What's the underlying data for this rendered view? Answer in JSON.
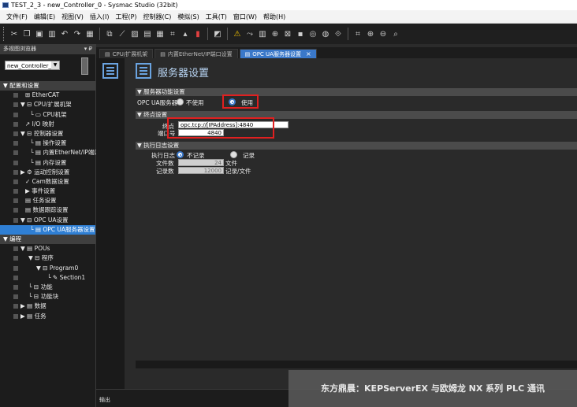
{
  "window": {
    "title": "TEST_2_3 - new_Controller_0 - Sysmac Studio (32bit)"
  },
  "menu": [
    "文件(F)",
    "编辑(E)",
    "视图(V)",
    "插入(I)",
    "工程(P)",
    "控制器(C)",
    "模拟(S)",
    "工具(T)",
    "窗口(W)",
    "帮助(H)"
  ],
  "toolbar": {
    "icons": [
      "cut-icon",
      "copy-icon",
      "paste-icon",
      "delete-icon",
      "undo-icon",
      "redo-icon",
      "build-icon",
      "find-icon",
      "replace-icon",
      "window-icon",
      "window2-icon",
      "cross-ref-icon",
      "search-icon",
      "toggle-icon",
      "flag-icon",
      "warning-icon",
      "online-icon",
      "sync-icon",
      "transfer-icon",
      "program-icon",
      "monitor-icon",
      "stop-icon",
      "run-icon",
      "sim-icon",
      "zoom-fit-icon",
      "zoom-in-icon",
      "zoom-out-icon",
      "zoom-reset-icon"
    ]
  },
  "left_panel": {
    "header": "多视图浏览器",
    "pin": "▾ ₽",
    "controller_select": "new_Controller_0",
    "tree": [
      {
        "label": "▼ 配置和设置",
        "indent": 4,
        "section": true
      },
      {
        "label": "⊞ EtherCAT",
        "indent": 32
      },
      {
        "label": "▼ ⊟ CPU/扩展机架",
        "indent": 26
      },
      {
        "label": "└ ▭ CPU机架",
        "indent": 38
      },
      {
        "label": "↗ I/O 映射",
        "indent": 32
      },
      {
        "label": "▼ ⊟ 控制器设置",
        "indent": 26
      },
      {
        "label": "└ ▤ 操作设置",
        "indent": 38
      },
      {
        "label": "└ ▤ 内置EtherNet/IP端口",
        "indent": 38
      },
      {
        "label": "└ ▤ 内存设置",
        "indent": 38
      },
      {
        "label": "▶ ⚙ 运动控制设置",
        "indent": 26
      },
      {
        "label": "✓ Cam数据设置",
        "indent": 32
      },
      {
        "label": "▶ 事件设置",
        "indent": 32
      },
      {
        "label": "▤ 任务设置",
        "indent": 32
      },
      {
        "label": "▤ 数据跟踪设置",
        "indent": 32
      },
      {
        "label": "▼ ⊟ OPC UA设置",
        "indent": 26
      },
      {
        "label": "└ ▤ OPC UA服务器设置",
        "indent": 38,
        "selected": true
      },
      {
        "label": "▼ 编程",
        "indent": 4,
        "section": true
      },
      {
        "label": "▼ ▤ POUs",
        "indent": 26
      },
      {
        "label": "▼ ⊟ 程序",
        "indent": 36
      },
      {
        "label": "▼ ⊟ Program0",
        "indent": 46
      },
      {
        "label": "└ ✎ Section1",
        "indent": 60
      },
      {
        "label": "└ ⊟ 功能",
        "indent": 36
      },
      {
        "label": "└ ⊟ 功能块",
        "indent": 36
      },
      {
        "label": "▶ ▤ 数据",
        "indent": 26
      },
      {
        "label": "▶ ▤ 任务",
        "indent": 26
      }
    ]
  },
  "tabs": [
    {
      "label": "CPU/扩展机架",
      "active": false
    },
    {
      "label": "内置EtherNet/IP端口设置",
      "active": false
    },
    {
      "label": "OPC UA服务器设置",
      "active": true,
      "close": "×"
    }
  ],
  "page": {
    "title": "服务器设置",
    "sections": {
      "server_function": "▼ 服务器功能设置",
      "endpoint": "▼ 终点设置",
      "log": "▼ 执行日志设置"
    },
    "server_label": "OPC UA服务器",
    "server_options": {
      "off": "不使用",
      "on": "使用"
    },
    "endpoint_label": "终点",
    "endpoint_value": "opc.tcp://[IPAddress]:4840",
    "port_label": "端口号",
    "port_value": "4840",
    "log_label": "执行日志",
    "log_options": {
      "off": "不记录",
      "on": "记录"
    },
    "file_count_label": "文件数",
    "file_count_value": "24",
    "file_unit": "文件",
    "record_count_label": "记录数",
    "record_count_value": "12000",
    "record_unit": "记录/文件"
  },
  "output": {
    "label": "输出"
  },
  "watermark": "东方鼎晨：KEPServerEX 与欧姆龙 NX 系列 PLC 通讯",
  "colors": {
    "accent": "#3a78c9",
    "highlight": "#e02020",
    "background": "#2a2a2a"
  }
}
